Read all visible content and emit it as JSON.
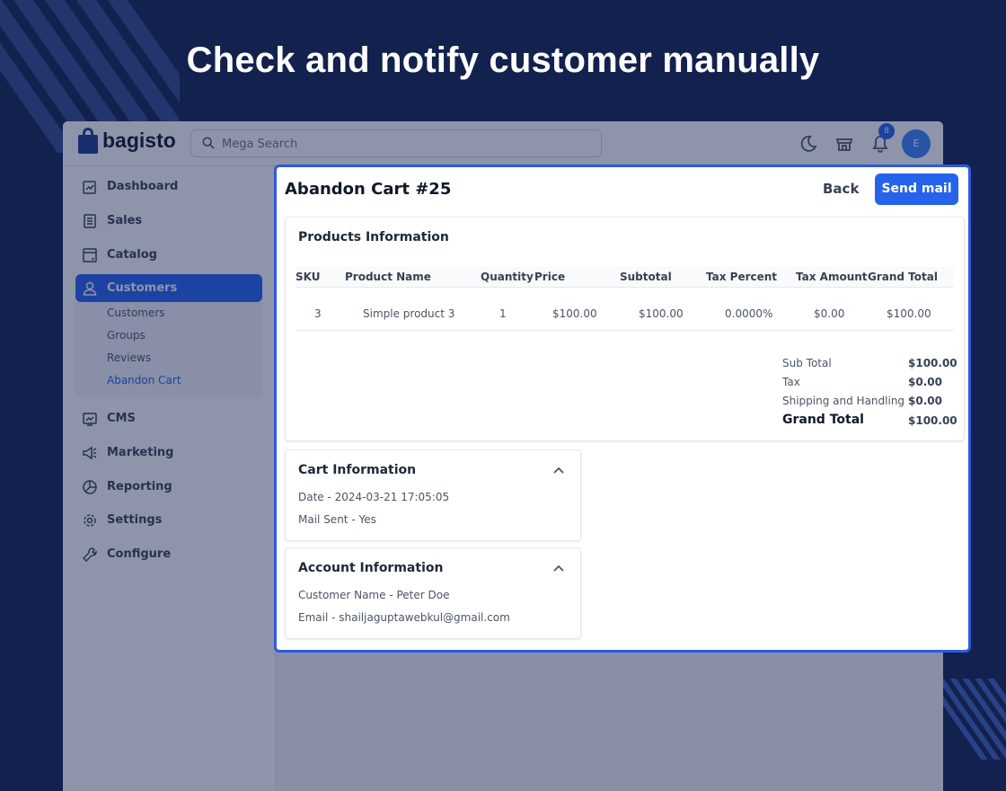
{
  "headline": "Check and notify customer manually",
  "topbar": {
    "logo_text": "bagisto",
    "search_placeholder": "Mega Search",
    "notification_count": "8",
    "avatar_initial": "E"
  },
  "sidebar": {
    "items": [
      {
        "label": "Dashboard",
        "icon": "dashboard-icon"
      },
      {
        "label": "Sales",
        "icon": "sales-icon"
      },
      {
        "label": "Catalog",
        "icon": "catalog-icon"
      },
      {
        "label": "Customers",
        "icon": "customers-icon"
      },
      {
        "label": "CMS",
        "icon": "cms-icon"
      },
      {
        "label": "Marketing",
        "icon": "marketing-icon"
      },
      {
        "label": "Reporting",
        "icon": "reporting-icon"
      },
      {
        "label": "Settings",
        "icon": "settings-icon"
      },
      {
        "label": "Configure",
        "icon": "configure-icon"
      }
    ],
    "submenu": [
      "Customers",
      "Groups",
      "Reviews",
      "Abandon Cart"
    ]
  },
  "panel": {
    "title": "Abandon Cart #25",
    "back_label": "Back",
    "send_label": "Send mail",
    "products": {
      "title": "Products Information",
      "columns": [
        "SKU",
        "Product Name",
        "Quantity",
        "Price",
        "Subtotal",
        "Tax Percent",
        "Tax Amount",
        "Grand Total"
      ],
      "rows": [
        [
          "3",
          "Simple product 3",
          "1",
          "$100.00",
          "$100.00",
          "0.0000%",
          "$0.00",
          "$100.00"
        ]
      ],
      "summary": {
        "sub_total_label": "Sub Total",
        "sub_total": "$100.00",
        "tax_label": "Tax",
        "tax": "$0.00",
        "shipping_label": "Shipping and Handling",
        "shipping": "$0.00",
        "grand_total_label": "Grand Total",
        "grand_total": "$100.00"
      }
    },
    "cart_info": {
      "title": "Cart Information",
      "date": "Date - 2024-03-21 17:05:05",
      "mail_sent": "Mail Sent - Yes"
    },
    "account_info": {
      "title": "Account Information",
      "name": "Customer Name - Peter Doe",
      "email": "Email - shailjaguptawebkul@gmail.com"
    }
  },
  "colors": {
    "page_bg": "#13214f",
    "accent": "#2563eb",
    "panel_border": "#2f59e0"
  }
}
